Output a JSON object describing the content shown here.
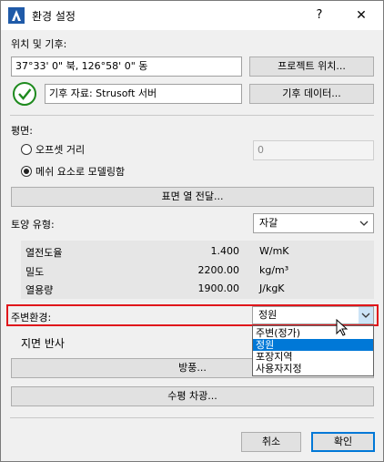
{
  "window": {
    "title": "환경 설정"
  },
  "titlebar": {
    "help": "?",
    "close": "✕"
  },
  "location": {
    "heading": "위치 및 기후:",
    "coords_value": "37°33' 0\" 북, 126°58' 0\" 동",
    "project_location_button": "프로젝트 위치...",
    "climate_value": "기후 자료: Strusoft 서버",
    "climate_data_button": "기후 데이터..."
  },
  "plane": {
    "heading": "평면:",
    "offset_label": "오프셋 거리",
    "offset_value": "0",
    "mesh_label": "메쉬 요소로 모델링함",
    "surface_button": "표면 열 전달..."
  },
  "soil": {
    "label": "토양 유형:",
    "selected": "자갈",
    "properties": [
      {
        "name": "열전도율",
        "value": "1.400",
        "unit": "W/mK"
      },
      {
        "name": "밀도",
        "value": "2200.00",
        "unit": "kg/m³"
      },
      {
        "name": "열용량",
        "value": "1900.00",
        "unit": "J/kgK"
      }
    ]
  },
  "surroundings": {
    "label": "주변환경:",
    "selected": "정원",
    "options": [
      "주변(정가)",
      "정원",
      "포장지역",
      "사용자지정"
    ],
    "highlight_color": "#e0161b"
  },
  "ground_reflection": {
    "label": "지면 반사"
  },
  "buttons": {
    "visit": "방풍...",
    "horizon": "수평 차광...",
    "cancel": "취소",
    "ok": "확인"
  },
  "colors": {
    "accent": "#0078d7",
    "check_green": "#1e8a1e"
  }
}
